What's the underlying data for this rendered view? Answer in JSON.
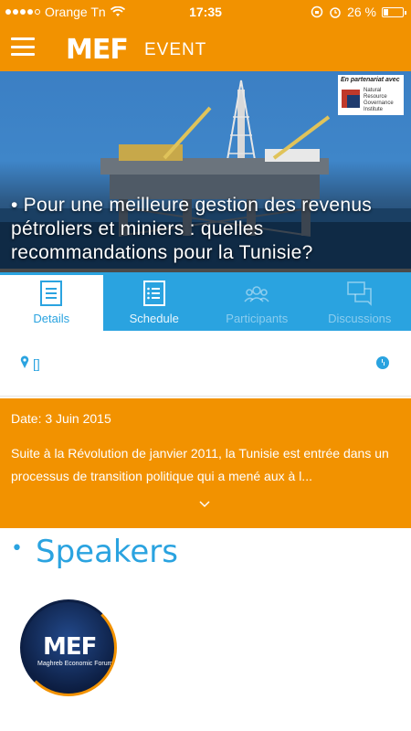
{
  "status": {
    "carrier": "Orange Tn",
    "time": "17:35",
    "battery": "26 %",
    "battery_level": 0.26
  },
  "header": {
    "logo": "MEF",
    "title": "EVENT",
    "menu_icon": "hamburger-menu-icon"
  },
  "hero": {
    "title": "Pour une meilleure gestion des revenus pétroliers et miniers : quelles recommandations pour la Tunisie?",
    "partner_label": "En partenariat avec",
    "partner_name": "Natural Resource Governance Institute"
  },
  "tabs": [
    {
      "label": "Details",
      "icon": "document-icon",
      "state": "active"
    },
    {
      "label": "Schedule",
      "icon": "list-icon",
      "state": "normal"
    },
    {
      "label": "Participants",
      "icon": "people-icon",
      "state": "disabled"
    },
    {
      "label": "Discussions",
      "icon": "chat-icon",
      "state": "disabled"
    }
  ],
  "location": {
    "text": "[]",
    "pin_icon": "location-pin-icon",
    "time_icon": "clock-icon"
  },
  "details": {
    "date": "Date: 3 Juin 2015",
    "description": "Suite à la Révolution de janvier 2011, la Tunisie est entrée dans un processus de transition politique qui a mené aux à l...",
    "expand_icon": "chevron-down-icon"
  },
  "speakers": {
    "title": "Speakers",
    "avatar_logo": "MEF",
    "avatar_caption": "Maghreb Economic Forum"
  },
  "colors": {
    "accent": "#f29200",
    "primary": "#2aa3e0"
  }
}
